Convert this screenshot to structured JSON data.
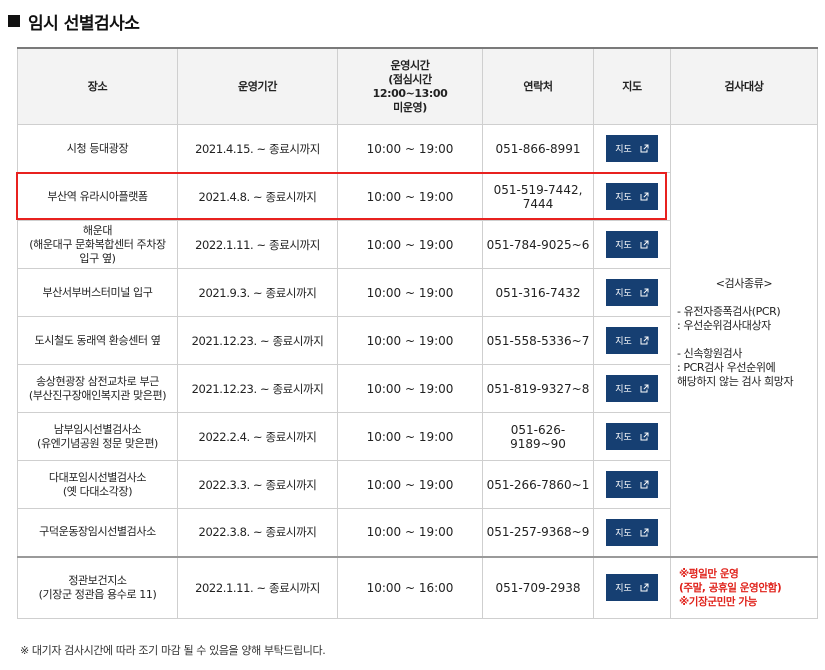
{
  "title": "임시 선별검사소",
  "headers": {
    "place": "장소",
    "period": "운영기간",
    "hours": "운영시간\n(점심시간\n12:00~13:00\n미운영)",
    "contact": "연락처",
    "map": "지도",
    "target": "검사대상"
  },
  "map_label": "지도",
  "rows": [
    {
      "place": "시청 등대광장",
      "period": "2021.4.15. ~ 종료시까지",
      "hours": "10:00 ~ 19:00",
      "phone": "051-866-8991"
    },
    {
      "place": "부산역 유라시아플랫폼",
      "period": "2021.4.8. ~ 종료시까지",
      "hours": "10:00 ~ 19:00",
      "phone": "051-519-7442,\n7444"
    },
    {
      "place": "해운대\n(해운대구 문화복합센터 주차장\n입구 옆)",
      "period": "2022.1.11. ~ 종료시까지",
      "hours": "10:00 ~ 19:00",
      "phone": "051-784-9025~6"
    },
    {
      "place": "부산서부버스터미널 입구",
      "period": "2021.9.3. ~ 종료시까지",
      "hours": "10:00 ~ 19:00",
      "phone": "051-316-7432"
    },
    {
      "place": "도시철도 동래역 환승센터 옆",
      "period": "2021.12.23. ~ 종료시까지",
      "hours": "10:00 ~ 19:00",
      "phone": "051-558-5336~7"
    },
    {
      "place": "송상현광장 삼전교차로 부근\n(부산진구장애인복지관 맞은편)",
      "period": "2021.12.23. ~ 종료시까지",
      "hours": "10:00 ~ 19:00",
      "phone": "051-819-9327~8"
    },
    {
      "place": "남부임시선별검사소\n(유엔기념공원 정문 맞은편)",
      "period": "2022.2.4. ~ 종료시까지",
      "hours": "10:00 ~ 19:00",
      "phone": "051-626-9189~90"
    },
    {
      "place": "다대포임시선별검사소\n(옛 다대소각장)",
      "period": "2022.3.3. ~ 종료시까지",
      "hours": "10:00 ~ 19:00",
      "phone": "051-266-7860~1"
    },
    {
      "place": "구덕운동장임시선별검사소",
      "period": "2022.3.8. ~ 종료시까지",
      "hours": "10:00 ~ 19:00",
      "phone": "051-257-9368~9"
    }
  ],
  "target_info": {
    "heading": "<검사종류>",
    "block1": "- 유전자증폭검사(PCR)\n: 우선순위검사대상자",
    "block2": "- 신속항원검사\n: PCR검사 우선순위에\n해당하지 않는 검사 희망자"
  },
  "last_row": {
    "place": "정관보건지소\n(기장군 정관읍 용수로 11)",
    "period": "2022.1.11. ~ 종료시까지",
    "hours": "10:00 ~ 16:00",
    "phone": "051-709-2938",
    "note": "※평일만 운영\n(주말, 공휴일 운영안함)\n※기장군민만 가능"
  },
  "footnote": "※ 대기자 검사시간에 따라 조기 마감 될 수 있음을 양해 부탁드립니다.",
  "colors": {
    "map_button": "#163f72",
    "highlight": "#e8211f",
    "note": "#e0221b"
  },
  "icons": {
    "map_link": "external-link-icon",
    "title_bullet": "square-bullet-icon"
  }
}
